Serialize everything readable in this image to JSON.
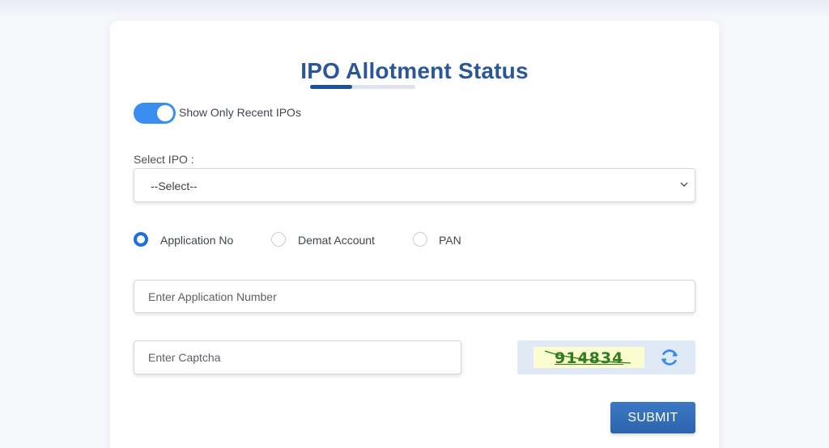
{
  "header": {
    "title": "IPO Allotment Status"
  },
  "toggle": {
    "label": "Show Only Recent IPOs",
    "enabled": true
  },
  "select_ipo": {
    "label": "Select IPO :",
    "selected": "--Select--"
  },
  "search_type": {
    "options": [
      "Application No",
      "Demat Account",
      "PAN"
    ],
    "selected": "Application No"
  },
  "application_input": {
    "placeholder": "Enter Application Number",
    "value": ""
  },
  "captcha": {
    "placeholder": "Enter Captcha",
    "value": "",
    "code": "914834"
  },
  "submit": {
    "label": "SUBMIT"
  },
  "colors": {
    "accent": "#1d6fe0",
    "title": "#2a579a",
    "submit": "#2f6bb8",
    "captcha_text": "#2f7d1c",
    "captcha_bg": "#fbfccf"
  }
}
